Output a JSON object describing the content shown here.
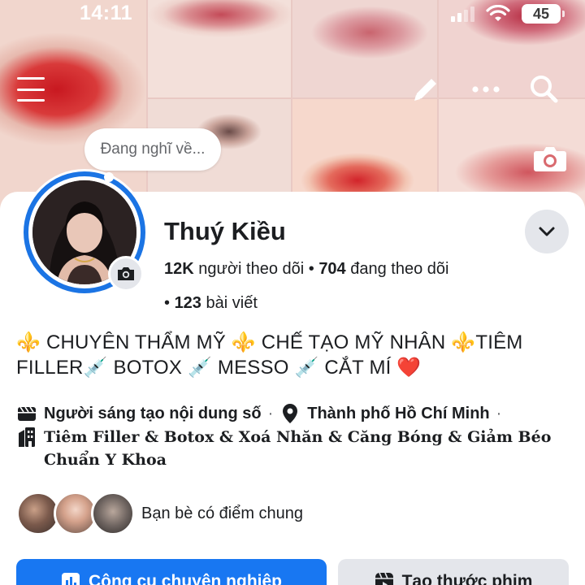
{
  "status_bar": {
    "time": "14:11",
    "battery": "45",
    "icons": [
      "cellular-signal-icon",
      "wifi-icon",
      "battery-icon"
    ]
  },
  "nav": {
    "icons": [
      "menu-icon",
      "pencil-icon",
      "more-icon",
      "search-icon",
      "camera-icon"
    ]
  },
  "thought_bubble": {
    "placeholder": "Đang nghĩ về..."
  },
  "profile": {
    "name": "Thuý Kiều",
    "followers_count": "12K",
    "followers_label": "người theo dõi",
    "following_count": "704",
    "following_label": "đang theo dõi",
    "posts_count": "123",
    "posts_label": "bài viết",
    "bio_line1": "⚜️ CHUYÊN THẨM MỸ ⚜️ CHẾ TẠO MỸ NHÂN ⚜️TIÊM",
    "bio_line2": "FILLER💉 BOTOX 💉 MESSO 💉 CẮT MÍ ❤️"
  },
  "details": {
    "creator": "Người sáng tạo nội dung số",
    "location": "Thành phố Hồ Chí Minh",
    "category": "Tiêm Filler & Botox & Xoá Nhăn & Căng Bóng & Giảm Béo Chuẩn Y Khoa"
  },
  "mutual_friends": {
    "label": "Bạn bè có điểm chung"
  },
  "actions": {
    "professional_label": "Công cụ chuyên nghiệp",
    "reel_label": "Tạo thước phim"
  },
  "colors": {
    "accent": "#1877f2",
    "story_ring": "#1b74e4",
    "button_gray": "#e4e6eb"
  }
}
